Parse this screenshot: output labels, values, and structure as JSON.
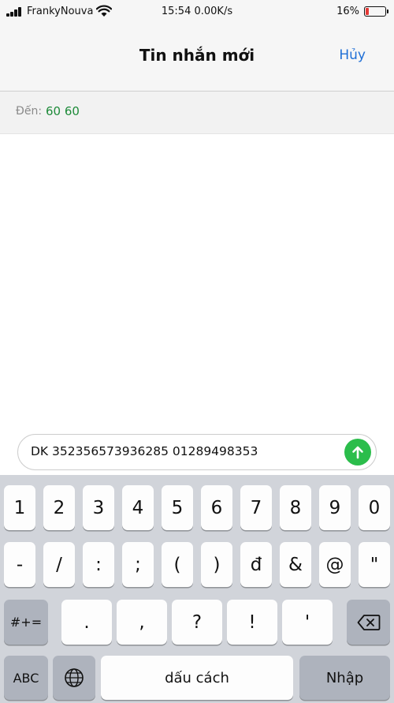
{
  "status_bar": {
    "carrier": "FrankyNouva",
    "time": "15:54 0.00K/s",
    "battery_percent": "16%",
    "battery_level": 0.16,
    "battery_color": "#e53935"
  },
  "nav": {
    "title": "Tin nhắn mới",
    "cancel_label": "Hủy",
    "accent_color": "#1f6fd6"
  },
  "recipient": {
    "label": "Đến:",
    "value": "60 60",
    "value_color": "#1e8b3a"
  },
  "composer": {
    "text": "DK 352356573936285 01289498353",
    "send_icon": "arrow-up-icon",
    "send_color": "#2bbd4b"
  },
  "keyboard": {
    "row1": [
      "1",
      "2",
      "3",
      "4",
      "5",
      "6",
      "7",
      "8",
      "9",
      "0"
    ],
    "row2": [
      "-",
      "/",
      ":",
      ";",
      "(",
      ")",
      "đ",
      "&",
      "@",
      "\""
    ],
    "row3_mode": "#+=",
    "row3": [
      ".",
      ",",
      "?",
      "!",
      "'"
    ],
    "row3_backspace_icon": "backspace-icon",
    "row4_abc": "ABC",
    "row4_globe_icon": "globe-icon",
    "row4_space": "dấu cách",
    "row4_return": "Nhập"
  }
}
